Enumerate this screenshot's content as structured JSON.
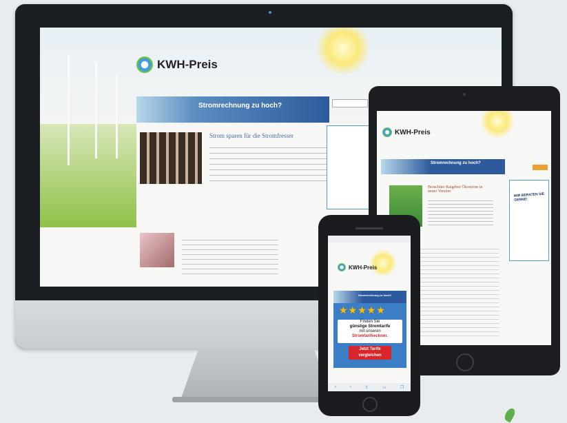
{
  "desktop": {
    "brand": "KWH-Preis",
    "banner_title": "Stromrechnung zu hoch?",
    "post_title": "Strom sparen für die Stromfresser"
  },
  "tablet": {
    "brand": "KWH-Preis",
    "banner_title": "Stromrechnung zu hoch?",
    "post_title": "Broschüre Ratgeber Ökostrom in neuer Version",
    "ad_text": "WIR BERATEN SIE GERNE!"
  },
  "phone": {
    "brand": "KWH-Preis",
    "banner_title": "Stromrechnung zu hoch?",
    "stars": "★★★★★",
    "ad_line1": "Finden Sie",
    "ad_line2": "günstige Stromtarife",
    "ad_line3": "mit unseren",
    "ad_line4": "Stromtarifrechner.",
    "cta": "Jetzt Tarife vergleichen"
  }
}
